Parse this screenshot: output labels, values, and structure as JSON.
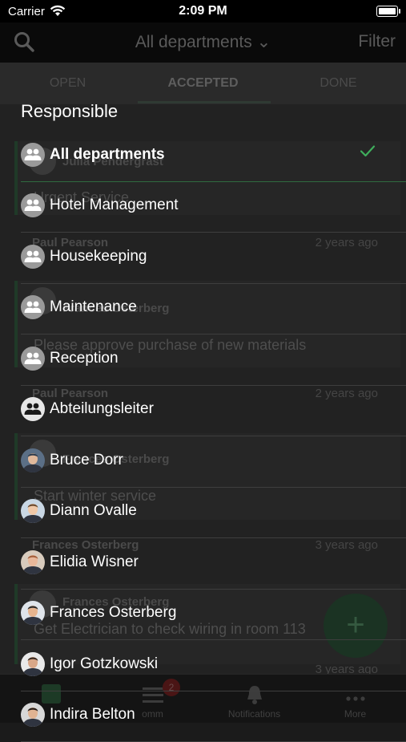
{
  "status": {
    "carrier": "Carrier",
    "time": "2:09 PM"
  },
  "navbar": {
    "title": "All departments ⌄",
    "filter": "Filter"
  },
  "tabs": [
    "OPEN",
    "ACCEPTED",
    "DONE"
  ],
  "cards": [
    {
      "assignee": "Julia Pendergrast",
      "task": "Urgent Service"
    },
    {
      "assignee": "Frances Osterberg",
      "task": "Please approve purchase of new materials"
    },
    {
      "assignee": "Frances Osterberg",
      "task": "Start winter service"
    },
    {
      "assignee": "Frances Osterberg",
      "task": "Get Electrician to check wiring in room 113"
    }
  ],
  "metas": [
    {
      "name": "Paul Pearson",
      "time": "2 years ago"
    },
    {
      "name": "Paul Pearson",
      "time": "2 years ago"
    },
    {
      "name": "Frances Osterberg",
      "time": "3 years ago"
    },
    {
      "name": "",
      "time": "3 years ago"
    }
  ],
  "tabbar": {
    "badge": "2",
    "notifications": "Notifications",
    "more": "More",
    "comm": "omm"
  },
  "fab_label": "+",
  "picker": {
    "heading": "Responsible",
    "items": [
      {
        "label": "All departments",
        "kind": "group",
        "selected": true
      },
      {
        "label": "Hotel Management",
        "kind": "group"
      },
      {
        "label": "Housekeeping",
        "kind": "group"
      },
      {
        "label": "Maintenance",
        "kind": "group"
      },
      {
        "label": "Reception",
        "kind": "group"
      },
      {
        "label": "Abteilungsleiter",
        "kind": "group-white"
      },
      {
        "label": "Bruce Dorr",
        "kind": "person"
      },
      {
        "label": "Diann Ovalle",
        "kind": "person"
      },
      {
        "label": "Elidia Wisner",
        "kind": "person"
      },
      {
        "label": "Frances Osterberg",
        "kind": "person"
      },
      {
        "label": "Igor Gotzkowski",
        "kind": "person"
      },
      {
        "label": "Indira Belton",
        "kind": "person"
      }
    ]
  },
  "colors": {
    "accent": "#3fae5c",
    "separator": "#3e3e3e",
    "group_icon": "#9a9a9a"
  }
}
